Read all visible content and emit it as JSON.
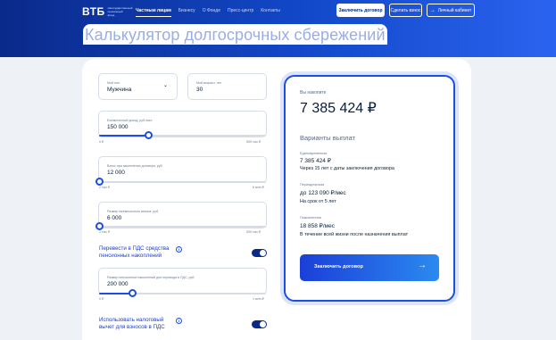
{
  "header": {
    "logo": "ВТБ",
    "logo_sub": "Негосударственный пенсионный фонд",
    "nav": [
      "Частным лицам",
      "Бизнесу",
      "О Фонде",
      "Пресс-центр",
      "Контакты"
    ],
    "btn_contract": "Заключить договор",
    "btn_deposit": "Сделать взнос",
    "btn_cabinet": "Личный кабинет",
    "cabinet_icon": "→"
  },
  "page_title": "Калькулятор долгосрочных сбережений",
  "form": {
    "gender": {
      "label": "Мой пол",
      "value": "Мужчина"
    },
    "age": {
      "label": "Мой возраст, лет",
      "value": "30"
    },
    "income": {
      "label": "Ежемесячный доход, руб./мес",
      "value": "150 000",
      "min": "0 ₽",
      "max": "500 тыс ₽",
      "fraction": 0.3
    },
    "initial": {
      "label": "Взнос при заключении договора, руб.",
      "value": "12 000",
      "min": "2 тыс ₽",
      "max": "6 млн ₽",
      "fraction": 0.0
    },
    "monthly": {
      "label": "Размер ежемесячного взноса, руб.",
      "value": "6 000",
      "min": "1 тыс ₽",
      "max": "500 тыс ₽",
      "fraction": 0.0
    },
    "pension_transfer": {
      "label": "Перевести в ПДС средства пенсионных накоплений",
      "on": true
    },
    "pension_amount": {
      "label": "Размер пенсионных накоплений для перевода в ПДС, руб.",
      "value": "200 000",
      "min": "0 ₽",
      "max": "1 млн ₽",
      "fraction": 0.2
    },
    "tax": {
      "label": "Использовать налоговый вычет для взносов в ПДС",
      "on": true
    }
  },
  "result": {
    "accumulate_label": "Вы накопите",
    "total": "7 385 424 ₽",
    "variants_heading": "Варианты выплат",
    "lump": {
      "label": "Единовременная",
      "value": "7 385 424 ₽",
      "note": "Через 15 лет с даты заключения договора"
    },
    "periodic": {
      "label": "Периодическая",
      "value": "до 123 090 ₽/мес",
      "note": "На срок от 5 лет"
    },
    "lifetime": {
      "label": "Пожизненная",
      "value": "18 858 ₽/мес",
      "note": "В течение всей жизни после назначения выплат"
    },
    "button": "Заключить договор",
    "arrow": "→"
  },
  "icons": {
    "chevron": "⌄",
    "info": "i"
  },
  "colors": {
    "accent": "#1a4fe0",
    "header": "#0a2a8a",
    "toggle": "#0a2a8a"
  }
}
